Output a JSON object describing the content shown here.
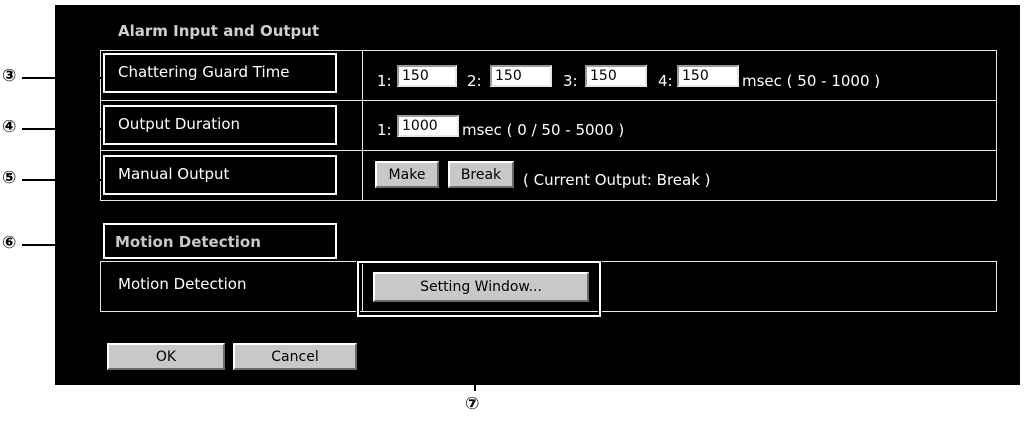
{
  "alarm_section": {
    "title": "Alarm Input and Output",
    "chattering": {
      "label": "Chattering Guard Time",
      "inputs": [
        {
          "prefix": "1:",
          "value": "150"
        },
        {
          "prefix": "2:",
          "value": "150"
        },
        {
          "prefix": "3:",
          "value": "150"
        },
        {
          "prefix": "4:",
          "value": "150"
        }
      ],
      "unit": "msec ( 50 - 1000 )"
    },
    "output_duration": {
      "label": "Output Duration",
      "prefix": "1:",
      "value": "1000",
      "unit": "msec ( 0 / 50 - 5000 )"
    },
    "manual_output": {
      "label": "Manual Output",
      "make_label": "Make",
      "break_label": "Break",
      "status": "( Current Output: Break )"
    }
  },
  "motion_section": {
    "title": "Motion Detection",
    "row_label": "Motion Detection",
    "setting_button": "Setting Window..."
  },
  "footer": {
    "ok_label": "OK",
    "cancel_label": "Cancel"
  },
  "callouts": {
    "c3": "③",
    "c4": "④",
    "c5": "⑤",
    "c6": "⑥",
    "c7": "⑦"
  }
}
